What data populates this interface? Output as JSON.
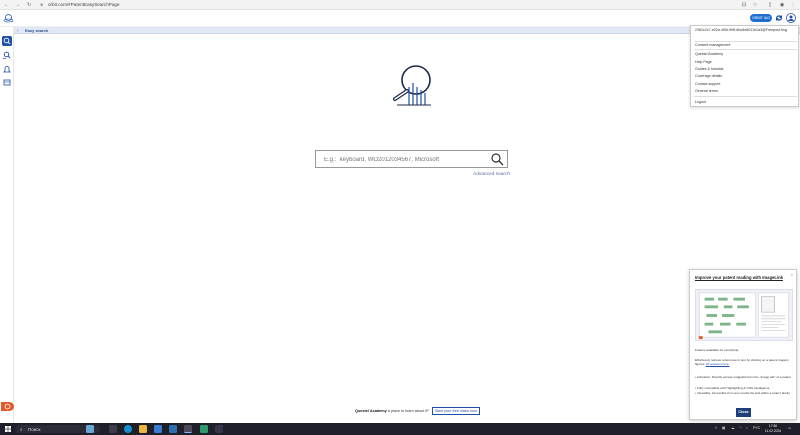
{
  "browser": {
    "url": "orbit.com/#PatentEasySearchPage",
    "icons": [
      "back-icon",
      "forward-icon",
      "reload-icon",
      "site-info-icon",
      "translate-icon",
      "bookmark-star-icon",
      "extensions-icon",
      "profile-icon",
      "kebab-menu-icon"
    ]
  },
  "header": {
    "orbit_button": "ORBIT IAG",
    "icons": [
      "orbit-logo-icon",
      "sync-icon",
      "user-account-icon"
    ]
  },
  "breadcrumb": {
    "title": "Easy search"
  },
  "search": {
    "placeholder": "E.g.:  keyboard, WO2012034567, Microsoft",
    "advanced_link": "Advanced search"
  },
  "account_menu": {
    "user_id": "2362c2c7-e02a-4f0b-9f9f-6bd4e8011b2a3@Freepost.fmg",
    "items": [
      "Consent management",
      "Questel Academy",
      "Help Page",
      "Guides & tutorials",
      "Coverage details",
      "Contact support",
      "General terms",
      "Logout"
    ]
  },
  "promo": {
    "title": "Improve your patent reading with ImageLink",
    "availability": "Feature available for everybody.",
    "desc_1": "Effortlessly retrieve references in text by clicking on a patent image's figures. ",
    "desc_link": "All answers here.",
    "bullet_1": "• Activation: Directly access imagelink from the \"image tab\" of a patent",
    "bullet_2": "• Fully compatible with Highlighting & Orbit intelligence",
    "bullet_3": "• Versatility: Accessible from any results list and within a patent family",
    "close_button": "Close",
    "close_x": "×"
  },
  "academy_footer": {
    "brand": "Questel Academy",
    "text": " a place to learn about IP",
    "cta": "Start your free class now"
  },
  "taskbar": {
    "search_label": "Поиск",
    "lang": "РУС",
    "time": "17:56",
    "date": "11.02.2024"
  },
  "colors": {
    "accent": "#1f4fa8",
    "orbit_button": "#1f6fd1",
    "help_tab": "#e25c2b",
    "crumb_bg": "#dfe8f4"
  }
}
